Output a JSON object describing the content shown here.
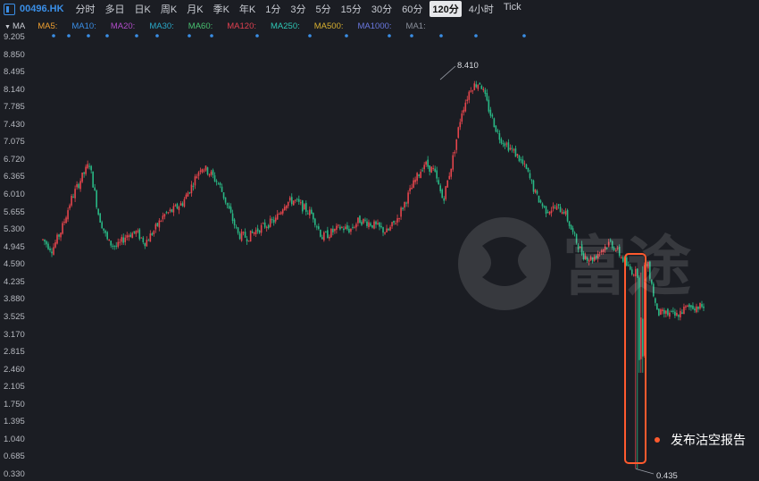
{
  "header": {
    "symbol": "00496.HK",
    "tabs": [
      "分时",
      "多日",
      "日K",
      "周K",
      "月K",
      "季K",
      "年K",
      "1分",
      "3分",
      "5分",
      "15分",
      "30分",
      "60分",
      "120分",
      "4小时",
      "Tick"
    ],
    "active_tab": "120分"
  },
  "indicators": {
    "label": "MA",
    "items": [
      {
        "name": "MA5",
        "color": "#f0a030"
      },
      {
        "name": "MA10",
        "color": "#3a8ee6"
      },
      {
        "name": "MA20",
        "color": "#b04cc8"
      },
      {
        "name": "MA30",
        "color": "#2aa9c9"
      },
      {
        "name": "MA60",
        "color": "#48c070"
      },
      {
        "name": "MA120",
        "color": "#e04050"
      },
      {
        "name": "MA250",
        "color": "#2ec6b5"
      },
      {
        "name": "MA500",
        "color": "#d8b030"
      },
      {
        "name": "MA1000",
        "color": "#6a78e0"
      },
      {
        "name": "MA1",
        "color": "#8a8f9a"
      }
    ]
  },
  "colors": {
    "up": "#e5454c",
    "down": "#29b885",
    "accent": "#3a8ee6",
    "highlight": "#ff5a2e",
    "background": "#1b1d23"
  },
  "annotation": {
    "text": "发布沽空报告"
  },
  "chart_data": {
    "type": "candlestick",
    "y_ticks": [
      "9.205",
      "8.850",
      "8.495",
      "8.140",
      "7.785",
      "7.430",
      "7.075",
      "6.720",
      "6.365",
      "6.010",
      "5.655",
      "5.300",
      "4.945",
      "4.590",
      "4.235",
      "3.880",
      "3.525",
      "3.170",
      "2.815",
      "2.460",
      "2.105",
      "1.750",
      "1.395",
      "1.040",
      "0.685",
      "0.330"
    ],
    "ylim": [
      0.33,
      9.205
    ],
    "max_label": "8.410",
    "min_label": "0.435",
    "path": [
      5.1,
      4.9,
      5.3,
      5.9,
      6.3,
      6.65,
      5.6,
      5.05,
      4.95,
      5.2,
      5.25,
      5.05,
      5.3,
      5.6,
      5.7,
      5.85,
      6.2,
      6.6,
      6.45,
      6.2,
      5.7,
      5.2,
      5.15,
      5.3,
      5.4,
      5.5,
      5.85,
      5.9,
      5.75,
      5.6,
      5.15,
      5.25,
      5.35,
      5.3,
      5.5,
      5.45,
      5.35,
      5.25,
      5.5,
      5.9,
      6.3,
      6.65,
      6.5,
      5.9,
      6.7,
      7.7,
      8.2,
      8.3,
      7.7,
      7.2,
      7.0,
      6.8,
      6.5,
      6.0,
      5.7,
      5.75,
      5.7,
      5.2,
      4.8,
      4.7,
      4.9,
      5.05,
      4.8,
      4.5,
      4.4,
      4.6,
      3.6,
      3.6,
      3.55,
      3.7,
      3.75,
      3.74
    ],
    "markers_count": 16
  }
}
